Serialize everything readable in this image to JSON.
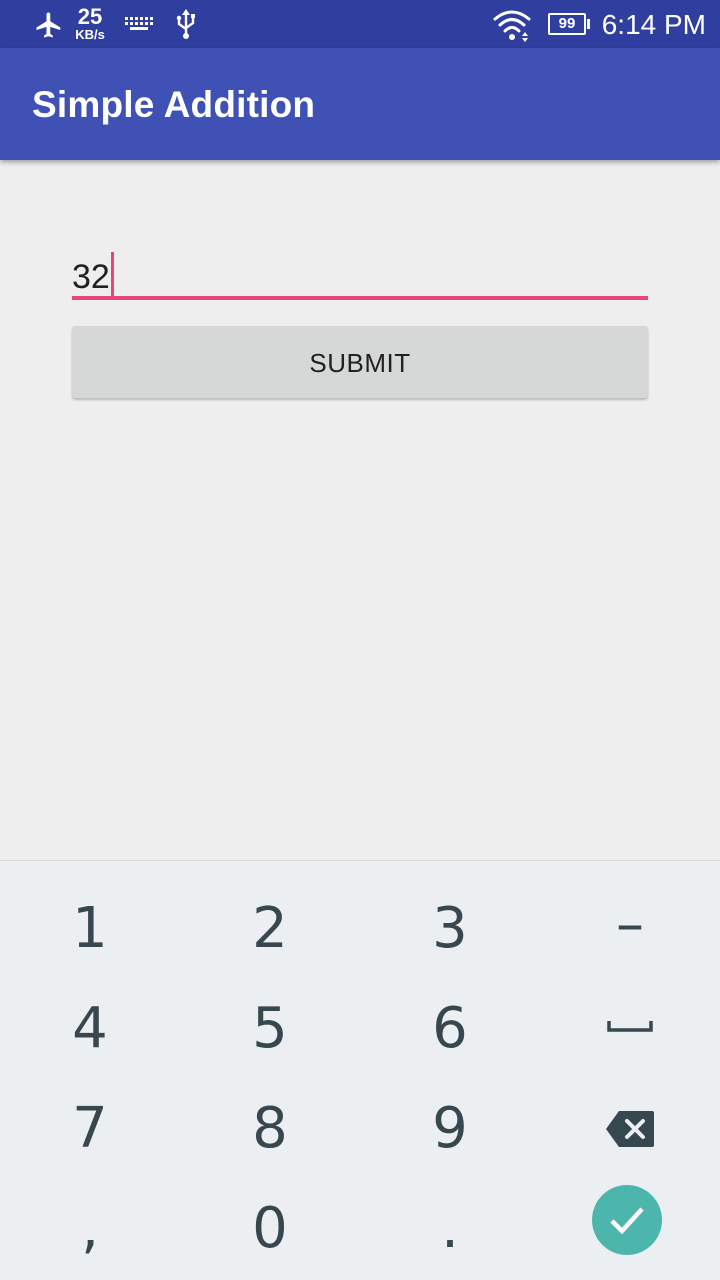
{
  "status_bar": {
    "network_speed_value": "25",
    "network_speed_unit": "KB/s",
    "battery_level": "99",
    "time": "6:14 PM",
    "icons": [
      "airplane-icon",
      "keyboard-icon",
      "usb-icon",
      "wifi-icon",
      "battery-icon"
    ]
  },
  "app_bar": {
    "title": "Simple Addition"
  },
  "form": {
    "input_value": "32",
    "submit_label": "SUBMIT"
  },
  "keyboard": {
    "keys": {
      "k1": "1",
      "k2": "2",
      "k3": "3",
      "minus": "–",
      "k4": "4",
      "k5": "5",
      "k6": "6",
      "k7": "7",
      "k8": "8",
      "k9": "9",
      "comma": ",",
      "k0": "0",
      "period": "."
    },
    "special_keys": [
      "space-icon",
      "backspace-icon",
      "done-check-icon"
    ]
  },
  "colors": {
    "status_bar": "#303f9f",
    "app_bar": "#3f51b5",
    "accent": "#e8437c",
    "done_button": "#4db6ac",
    "keyboard_bg": "#eceff1",
    "key_text": "#37474f"
  }
}
